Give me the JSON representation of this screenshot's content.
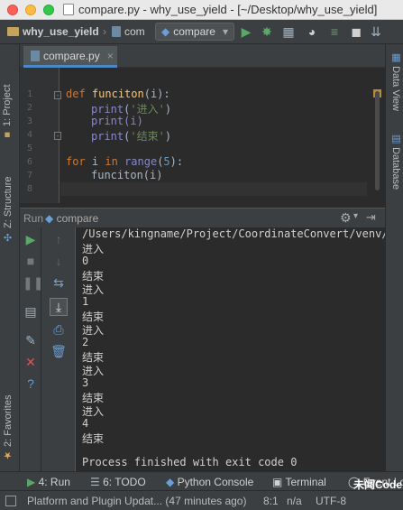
{
  "window": {
    "title": "compare.py - why_use_yield - [~/Desktop/why_use_yield]"
  },
  "navbar": {
    "project": "why_use_yield",
    "file_crumb": "com",
    "run_config": "compare"
  },
  "left_strip": {
    "project_tab": "1: Project",
    "structure_tab": "Z: Structure",
    "favorites_tab": "2: Favorites"
  },
  "right_strip": {
    "sciview_tab": "Data View",
    "database_tab": "Database"
  },
  "editor": {
    "tab_label": "compare.py",
    "line_numbers": [
      "1",
      "2",
      "3",
      "4",
      "5",
      "6",
      "7",
      "8"
    ]
  },
  "code": {
    "l1": {
      "kw": "def",
      "name": "funciton",
      "rest": "(i):"
    },
    "l2": {
      "fn": "print",
      "open": "(",
      "str": "'进入'",
      "close": ")"
    },
    "l3": {
      "text": "print(i)"
    },
    "l4": {
      "fn": "print",
      "open": "(",
      "str": "'结束'",
      "close": ")"
    },
    "l6": {
      "kw1": "for",
      "var": " i ",
      "kw2": "in",
      "sp": " ",
      "fn": "range",
      "open": "(",
      "num": "5",
      "close": "):"
    },
    "l7": {
      "text": "funciton(i)"
    }
  },
  "run_panel": {
    "label": "Run",
    "config": "compare"
  },
  "console": {
    "lines": [
      "/Users/kingname/Project/CoordinateConvert/venv/b",
      "进入",
      "0",
      "结束",
      "进入",
      "1",
      "结束",
      "进入",
      "2",
      "结束",
      "进入",
      "3",
      "结束",
      "进入",
      "4",
      "结束",
      "",
      "Process finished with exit code 0"
    ]
  },
  "tool_tabs": {
    "run": "4: Run",
    "todo": "6: TODO",
    "python_console": "Python Console",
    "terminal": "Terminal",
    "event_log": "Event Lo"
  },
  "status": {
    "message": "Platform and Plugin Updat... (47 minutes ago)",
    "position": "8:1",
    "line_sep": "n/a",
    "encoding": "UTF-8",
    "watermark": "未闻Code"
  },
  "colors": {
    "accent": "#4a88c7",
    "keyword": "#cc7832",
    "string": "#6a8759"
  }
}
